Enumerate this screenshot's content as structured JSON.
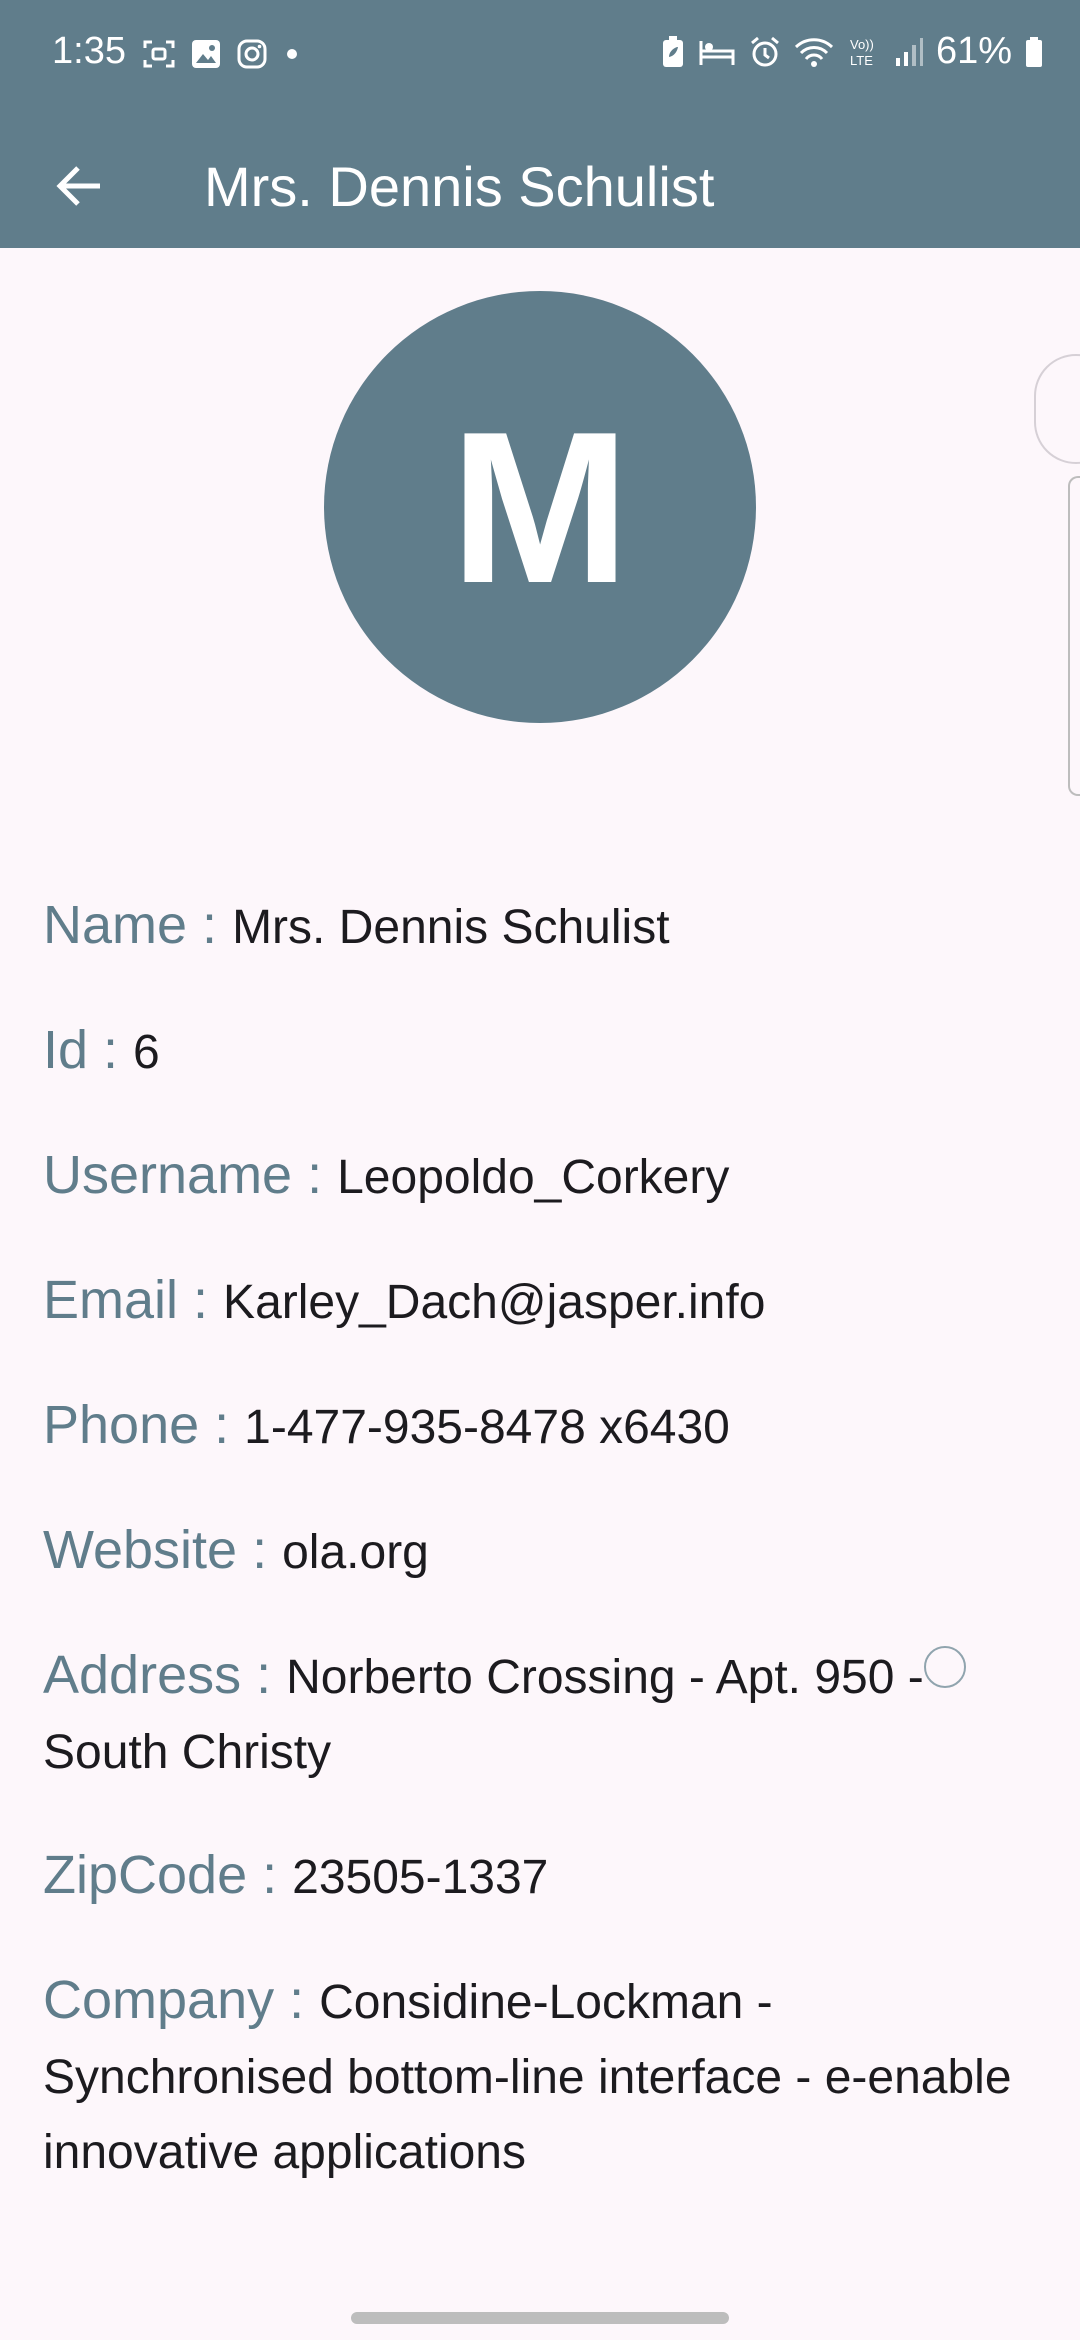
{
  "status_bar": {
    "time": "1:35",
    "battery": "61%",
    "left_icons": [
      "screenshot-icon",
      "gallery-icon",
      "instagram-icon",
      "dot-icon"
    ],
    "right_icons": [
      "battery-saver-icon",
      "bed-icon",
      "alarm-icon",
      "wifi-icon",
      "volte-icon",
      "signal-icon",
      "battery-icon"
    ]
  },
  "app_bar": {
    "title": "Mrs. Dennis Schulist"
  },
  "avatar": {
    "initial": "M"
  },
  "details": [
    {
      "label": "Name : ",
      "value": "Mrs. Dennis Schulist"
    },
    {
      "label": "Id : ",
      "value": "6"
    },
    {
      "label": "Username : ",
      "value": "Leopoldo_Corkery"
    },
    {
      "label": "Email : ",
      "value": "Karley_Dach@jasper.info"
    },
    {
      "label": "Phone : ",
      "value": "1-477-935-8478 x6430"
    },
    {
      "label": "Website : ",
      "value": "ola.org"
    },
    {
      "label": "Address : ",
      "value": "Norberto Crossing - Apt. 950 - South Christy"
    },
    {
      "label": "ZipCode : ",
      "value": "23505-1337"
    },
    {
      "label": "Company : ",
      "value": "Considine-Lockman - Synchronised bottom-line interface - e-enable innovative applications"
    }
  ],
  "colors": {
    "primary": "#607D8B",
    "background": "#FDF7FB",
    "text": "#1C1B1F"
  }
}
